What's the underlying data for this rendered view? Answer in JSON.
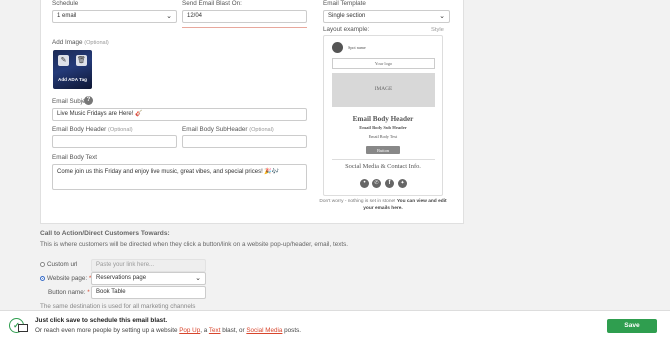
{
  "schedule": {
    "label": "Schedule",
    "value": "1 email"
  },
  "send_date": {
    "label": "Send Email Blast On:",
    "value": "12/04"
  },
  "template": {
    "label": "Email Template",
    "value": "Single section",
    "layout_label": "Layout example:",
    "style_label": "Style"
  },
  "add_image": {
    "label": "Add Image",
    "optional": "(Optional)",
    "ada_tag": "Add ADA Tag"
  },
  "subject": {
    "label": "Email Subject",
    "help": "?",
    "value": "Live Music Fridays are Here! 🎸"
  },
  "body_header": {
    "label": "Email Body Header",
    "optional": "(Optional)",
    "value": ""
  },
  "body_subheader": {
    "label": "Email Body SubHeader",
    "optional": "(Optional)",
    "value": ""
  },
  "body_text": {
    "label": "Email Body Text",
    "value": "Come join us this Friday and enjoy live music, great vibes, and special prices! 🎉🎶"
  },
  "preview": {
    "spot_name": "Spot name",
    "logo": "Your logo",
    "image": "IMAGE",
    "header": "Email Body Header",
    "subheader": "Email Body Sub Header",
    "text": "Email Body Text",
    "button": "Button",
    "social": "Social Media & Contact Info.",
    "note_prefix": "Don't worry - nothing is set in stone!",
    "note_suffix": "You can view and edit your emails here."
  },
  "cta": {
    "heading": "Call to Action/Direct Customers Towards:",
    "description": "This is where customers will be directed when they click a button/link on a website pop-up/header, email, texts.",
    "custom_url_label": "Custom url",
    "custom_url_placeholder": "Paste your link here...",
    "website_page_label": "Website page:",
    "website_page_value": "Reservations page",
    "button_name_label": "Button name:",
    "button_name_value": "Book Table",
    "required_mark": "*",
    "note": "The same destination is used for all marketing channels"
  },
  "footer": {
    "title": "Just click save to schedule this email blast.",
    "line_prefix": "Or reach even more people by setting up a website",
    "link_popup": "Pop Up",
    "sep1": ", a",
    "link_text": "Text",
    "sep2": "blast, or",
    "link_social": "Social Media",
    "suffix": "posts.",
    "save_label": "Save"
  },
  "colors": {
    "accent_red": "#d8452c",
    "save_green": "#2f9e4f",
    "radio_blue": "#3a6ec8"
  }
}
